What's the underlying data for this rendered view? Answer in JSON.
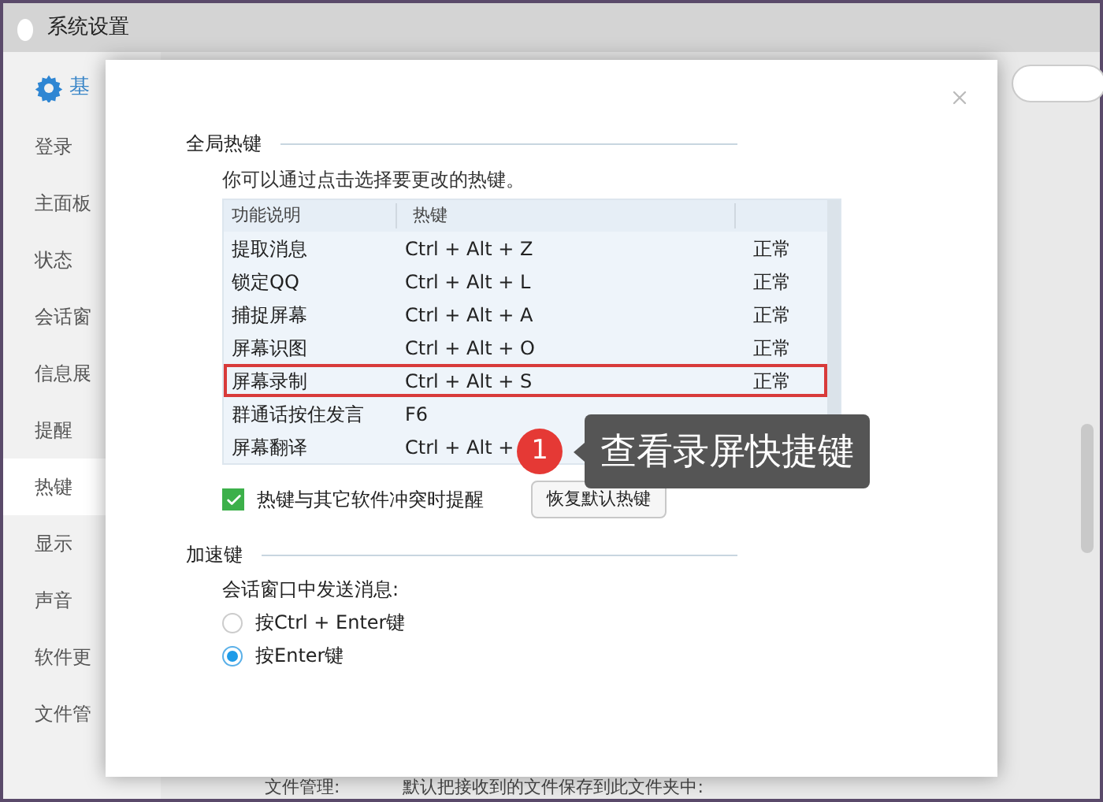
{
  "window": {
    "title": "系统设置"
  },
  "sidebar": {
    "items": [
      {
        "label": "基",
        "selected": false,
        "kind": "header"
      },
      {
        "label": "登录",
        "selected": false,
        "kind": "item"
      },
      {
        "label": "主面板",
        "selected": false,
        "kind": "item"
      },
      {
        "label": "状态",
        "selected": false,
        "kind": "item"
      },
      {
        "label": "会话窗",
        "selected": false,
        "kind": "item"
      },
      {
        "label": "信息展",
        "selected": false,
        "kind": "item"
      },
      {
        "label": "提醒",
        "selected": false,
        "kind": "item"
      },
      {
        "label": "热键",
        "selected": true,
        "kind": "item"
      },
      {
        "label": "显示",
        "selected": false,
        "kind": "item"
      },
      {
        "label": "声音",
        "selected": false,
        "kind": "item"
      },
      {
        "label": "软件更",
        "selected": false,
        "kind": "item"
      },
      {
        "label": "文件管",
        "selected": false,
        "kind": "item"
      }
    ]
  },
  "background_text": {
    "label": "文件管理:",
    "value": "默认把接收到的文件保存到此文件夹中:"
  },
  "dialog": {
    "global_hotkeys": {
      "title": "全局热键",
      "hint": "你可以通过点击选择要更改的热键。",
      "table": {
        "columns": [
          "功能说明",
          "热键"
        ],
        "rows": [
          {
            "function": "提取消息",
            "hotkey": "Ctrl + Alt + Z",
            "status": "正常",
            "highlighted": false
          },
          {
            "function": "锁定QQ",
            "hotkey": "Ctrl + Alt + L",
            "status": "正常",
            "highlighted": false
          },
          {
            "function": "捕捉屏幕",
            "hotkey": "Ctrl + Alt + A",
            "status": "正常",
            "highlighted": false
          },
          {
            "function": "屏幕识图",
            "hotkey": "Ctrl + Alt + O",
            "status": "正常",
            "highlighted": false
          },
          {
            "function": "屏幕录制",
            "hotkey": "Ctrl + Alt + S",
            "status": "正常",
            "highlighted": true
          },
          {
            "function": "群通话按住发言",
            "hotkey": "F6",
            "highlighted": false
          },
          {
            "function": "屏幕翻译",
            "hotkey": "Ctrl + Alt +",
            "highlighted": false
          }
        ]
      },
      "conflict_checkbox": {
        "label": "热键与其它软件冲突时提醒",
        "checked": true
      },
      "restore_button": "恢复默认热键"
    },
    "accelerator": {
      "title": "加速键",
      "prompt": "会话窗口中发送消息:",
      "options": [
        {
          "label": "按Ctrl + Enter键",
          "selected": false
        },
        {
          "label": "按Enter键",
          "selected": true
        }
      ]
    }
  },
  "callout": {
    "number": "1",
    "text": "查看录屏快捷键"
  }
}
